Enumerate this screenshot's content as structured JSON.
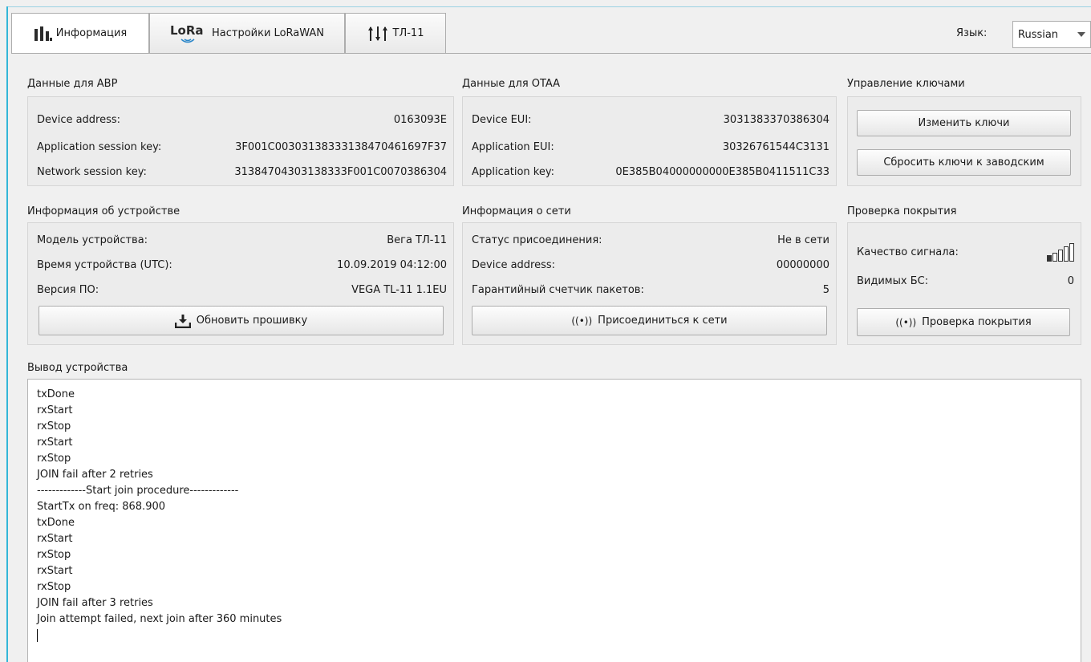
{
  "tabs": [
    {
      "label": "Информация",
      "icon": "bar-chart-icon"
    },
    {
      "label": "Настройки LoRaWAN",
      "icon": "lora-logo-icon",
      "logo_text": "LoRa"
    },
    {
      "label": "ТЛ-11",
      "icon": "sliders-icon"
    }
  ],
  "language": {
    "label": "Язык:",
    "value": "Russian"
  },
  "abp": {
    "title": "Данные для ABP",
    "rows": [
      {
        "label": "Device address:",
        "value": "0163093E"
      },
      {
        "label": "Application session key:",
        "value": "3F001C003031383331384704616 97F37"
      },
      {
        "label": "Network session key:",
        "value": "3138470430313833 3F001C0070386304"
      }
    ]
  },
  "otaa": {
    "title": "Данные для OTAA",
    "rows": [
      {
        "label": "Device EUI:",
        "value": "3031383370386304"
      },
      {
        "label": "Application EUI:",
        "value": "30326761544C3131"
      },
      {
        "label": "Application key:",
        "value": "0E385B04000000000E385B0411511C33"
      }
    ]
  },
  "keys": {
    "title": "Управление ключами",
    "change_label": "Изменить ключи",
    "reset_label": "Сбросить ключи к заводским"
  },
  "device": {
    "title": "Информация об устройстве",
    "rows": [
      {
        "label": "Модель устройства:",
        "value": "Вега ТЛ-11"
      },
      {
        "label": "Время устройства (UTC):",
        "value": "10.09.2019 04:12:00"
      },
      {
        "label": "Версия ПО:",
        "value": "VEGA TL-11 1.1EU"
      }
    ],
    "update_label": "Обновить прошивку"
  },
  "network": {
    "title": "Информация о сети",
    "rows": [
      {
        "label": "Статус присоединения:",
        "value": "Не в сети"
      },
      {
        "label": "Device address:",
        "value": "00000000"
      },
      {
        "label": "Гарантийный счетчик пакетов:",
        "value": "5"
      }
    ],
    "join_label": "Присоединиться к сети"
  },
  "coverage": {
    "title": "Проверка покрытия",
    "signal_label": "Качество сигнала:",
    "signal_level": 0.2,
    "bs_label": "Видимых БС:",
    "bs_value": "0",
    "check_label": "Проверка покрытия"
  },
  "output": {
    "title": "Вывод устройства",
    "lines": [
      "txDone",
      "rxStart",
      "rxStop",
      "rxStart",
      "rxStop",
      "JOIN fail after 2 retries",
      "-------------Start join procedure-------------",
      "StartTx on freq: 868.900",
      "txDone",
      "rxStart",
      "rxStop",
      "rxStart",
      "rxStop",
      "JOIN fail after 3 retries",
      "Join attempt failed, next join after 360 minutes"
    ]
  }
}
